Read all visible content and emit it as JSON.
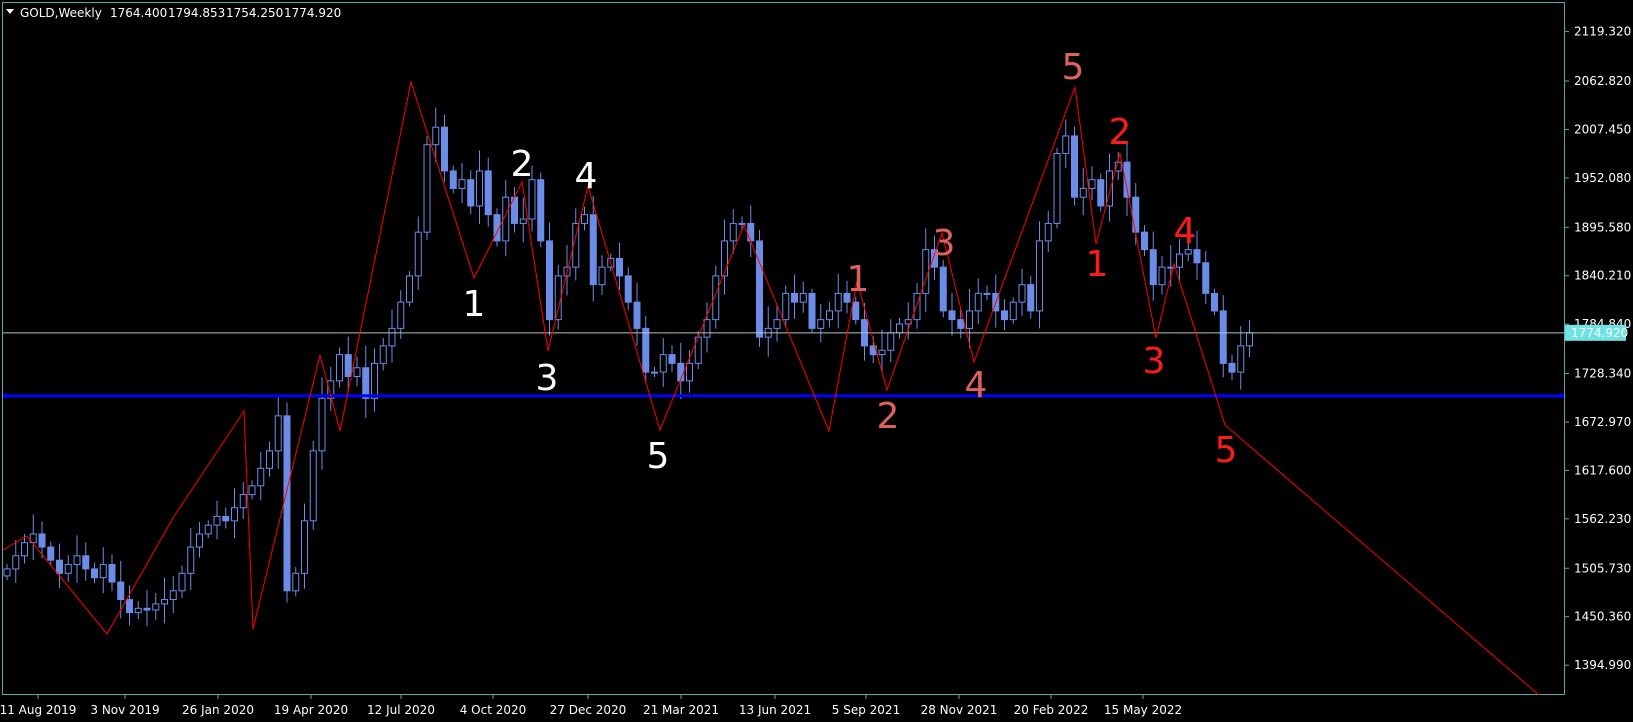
{
  "header": {
    "symbol": "GOLD,Weekly",
    "open": "1764.400",
    "high": "1794.853",
    "low": "1754.250",
    "close": "1774.920"
  },
  "colors": {
    "background": "#000000",
    "frame": "#5fa7a7",
    "candle": "#6b8de8",
    "zigzag": "#ff0000",
    "support_line": "#0000ff",
    "price_line": "#b7c4c4",
    "current_price_box": "#6fe3e3",
    "label_white": "#ffffff",
    "label_rose": "#e06060",
    "label_red": "#ff1a1a"
  },
  "chart_data": {
    "type": "candlestick",
    "title": "GOLD,Weekly",
    "ylim": [
      1362,
      2152
    ],
    "y_ticks": [
      "2119.320",
      "2062.820",
      "2007.450",
      "1952.080",
      "1895.580",
      "1840.210",
      "1784.840",
      "1728.340",
      "1672.970",
      "1617.600",
      "1562.230",
      "1505.730",
      "1450.360",
      "1394.990"
    ],
    "x_ticks": [
      "11 Aug 2019",
      "3 Nov 2019",
      "26 Jan 2020",
      "19 Apr 2020",
      "12 Jul 2020",
      "4 Oct 2020",
      "27 Dec 2020",
      "21 Mar 2021",
      "13 Jun 2021",
      "5 Sep 2021",
      "28 Nov 2021",
      "20 Feb 2022",
      "15 May 2022"
    ],
    "current_price": "1774.920",
    "support_level": 1703,
    "candle_closes": [
      1505,
      1520,
      1535,
      1545,
      1530,
      1515,
      1500,
      1510,
      1520,
      1505,
      1495,
      1510,
      1490,
      1470,
      1455,
      1460,
      1458,
      1465,
      1470,
      1480,
      1500,
      1530,
      1545,
      1555,
      1565,
      1560,
      1575,
      1590,
      1600,
      1620,
      1640,
      1680,
      1480,
      1500,
      1560,
      1640,
      1700,
      1720,
      1750,
      1725,
      1735,
      1700,
      1740,
      1760,
      1780,
      1810,
      1840,
      1890,
      1990,
      2010,
      1960,
      1940,
      1950,
      1920,
      1960,
      1910,
      1880,
      1930,
      1900,
      1905,
      1950,
      1880,
      1790,
      1840,
      1850,
      1900,
      1910,
      1830,
      1850,
      1860,
      1840,
      1810,
      1780,
      1730,
      1730,
      1750,
      1740,
      1720,
      1740,
      1770,
      1790,
      1840,
      1880,
      1900,
      1900,
      1880,
      1770,
      1780,
      1790,
      1820,
      1810,
      1820,
      1780,
      1790,
      1800,
      1820,
      1810,
      1790,
      1760,
      1750,
      1755,
      1775,
      1785,
      1790,
      1820,
      1870,
      1850,
      1800,
      1790,
      1780,
      1800,
      1820,
      1820,
      1800,
      1790,
      1810,
      1830,
      1800,
      1880,
      1900,
      1980,
      2000,
      1930,
      1940,
      1950,
      1920,
      1960,
      1970,
      1930,
      1890,
      1870,
      1830,
      1850,
      1850,
      1865,
      1870,
      1855,
      1820,
      1800,
      1740,
      1730,
      1760,
      1775
    ]
  },
  "wave_labels": [
    {
      "text": "1",
      "color_key": "label_white"
    },
    {
      "text": "2",
      "color_key": "label_white"
    },
    {
      "text": "3",
      "color_key": "label_white"
    },
    {
      "text": "4",
      "color_key": "label_white"
    },
    {
      "text": "5",
      "color_key": "label_white"
    },
    {
      "text": "1",
      "color_key": "label_rose"
    },
    {
      "text": "2",
      "color_key": "label_rose"
    },
    {
      "text": "3",
      "color_key": "label_rose"
    },
    {
      "text": "4",
      "color_key": "label_rose"
    },
    {
      "text": "5",
      "color_key": "label_rose"
    },
    {
      "text": "1",
      "color_key": "label_red"
    },
    {
      "text": "2",
      "color_key": "label_red"
    },
    {
      "text": "3",
      "color_key": "label_red"
    },
    {
      "text": "4",
      "color_key": "label_red"
    },
    {
      "text": "5",
      "color_key": "label_red"
    }
  ]
}
